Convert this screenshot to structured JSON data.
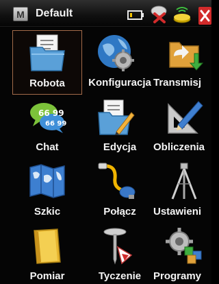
{
  "titlebar": {
    "menu_letter": "M",
    "title": "Default",
    "icons": [
      "menu-icon",
      "battery-icon",
      "no-satellite-icon",
      "radio-icon",
      "close-icon"
    ]
  },
  "tiles": [
    {
      "label": "Robota",
      "icon": "folder-icon",
      "selected": true
    },
    {
      "label": "Konfiguracja",
      "icon": "globe-gear-icon",
      "selected": false
    },
    {
      "label": "Transmisj",
      "icon": "transfer-icon",
      "selected": false
    },
    {
      "label": "Chat",
      "icon": "chat-icon",
      "selected": false
    },
    {
      "label": "Edycja",
      "icon": "edit-icon",
      "selected": false
    },
    {
      "label": "Obliczenia",
      "icon": "calculate-icon",
      "selected": false
    },
    {
      "label": "Szkic",
      "icon": "map-icon",
      "selected": false
    },
    {
      "label": "Połącz",
      "icon": "connect-icon",
      "selected": false
    },
    {
      "label": "Ustawieni",
      "icon": "tripod-icon",
      "selected": false
    },
    {
      "label": "Pomiar",
      "icon": "measure-icon",
      "selected": false
    },
    {
      "label": "Tyczenie",
      "icon": "stakeout-icon",
      "selected": false
    },
    {
      "label": "Programy",
      "icon": "programs-icon",
      "selected": false
    }
  ],
  "colors": {
    "background": "#050505",
    "selection_border": "#a36b4a",
    "close": "#d22b2b"
  }
}
